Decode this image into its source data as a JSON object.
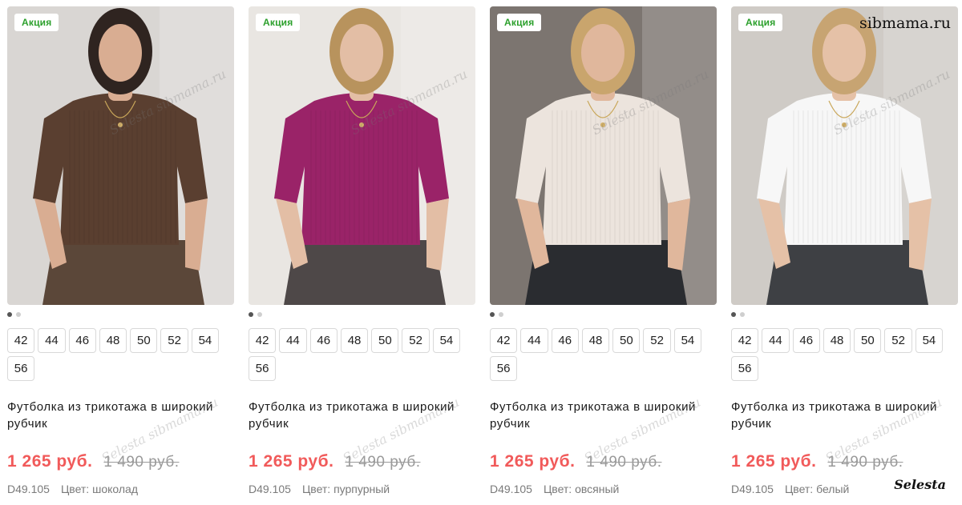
{
  "products": [
    {
      "badge": "Акция",
      "colors": {
        "bg": "#d9d6d3",
        "top": "#5a3f30",
        "bottom": "#5b4739",
        "skin": "#d9ad92",
        "hair": "#2f2420"
      },
      "sizes": [
        "42",
        "44",
        "46",
        "48",
        "50",
        "52",
        "54",
        "56"
      ],
      "title": "Футболка из трикотажа в широкий рубчик",
      "price_new": "1 265 руб.",
      "price_old": "1 490 руб.",
      "sku": "D49.105",
      "color_label": "Цвет: шоколад"
    },
    {
      "badge": "Акция",
      "colors": {
        "bg": "#e9e6e2",
        "top": "#9a2368",
        "bottom": "#4e4848",
        "skin": "#e3bea5",
        "hair": "#b8935d"
      },
      "sizes": [
        "42",
        "44",
        "46",
        "48",
        "50",
        "52",
        "54",
        "56"
      ],
      "title": "Футболка из трикотажа в широкий рубчик",
      "price_new": "1 265 руб.",
      "price_old": "1 490 руб.",
      "sku": "D49.105",
      "color_label": "Цвет: пурпурный"
    },
    {
      "badge": "Акция",
      "colors": {
        "bg": "#7c7570",
        "top": "#ece4dd",
        "bottom": "#2a2c30",
        "skin": "#e0b79c",
        "hair": "#c9a56d"
      },
      "sizes": [
        "42",
        "44",
        "46",
        "48",
        "50",
        "52",
        "54",
        "56"
      ],
      "title": "Футболка из трикотажа в широкий рубчик",
      "price_new": "1 265 руб.",
      "price_old": "1 490 руб.",
      "sku": "D49.105",
      "color_label": "Цвет: овсяный"
    },
    {
      "badge": "Акция",
      "colors": {
        "bg": "#cfcbc6",
        "top": "#f7f7f7",
        "bottom": "#3e4044",
        "skin": "#e5c1a7",
        "hair": "#c7a472"
      },
      "sizes": [
        "42",
        "44",
        "46",
        "48",
        "50",
        "52",
        "54",
        "56"
      ],
      "title": "Футболка из трикотажа в широкий рубчик",
      "price_new": "1 265 руб.",
      "price_old": "1 490 руб.",
      "sku": "D49.105",
      "color_label": "Цвет: белый"
    }
  ],
  "watermarks": {
    "site": "sibmama.ru",
    "brand": "Selesta",
    "faint": "Selesta sibmama.ru"
  }
}
